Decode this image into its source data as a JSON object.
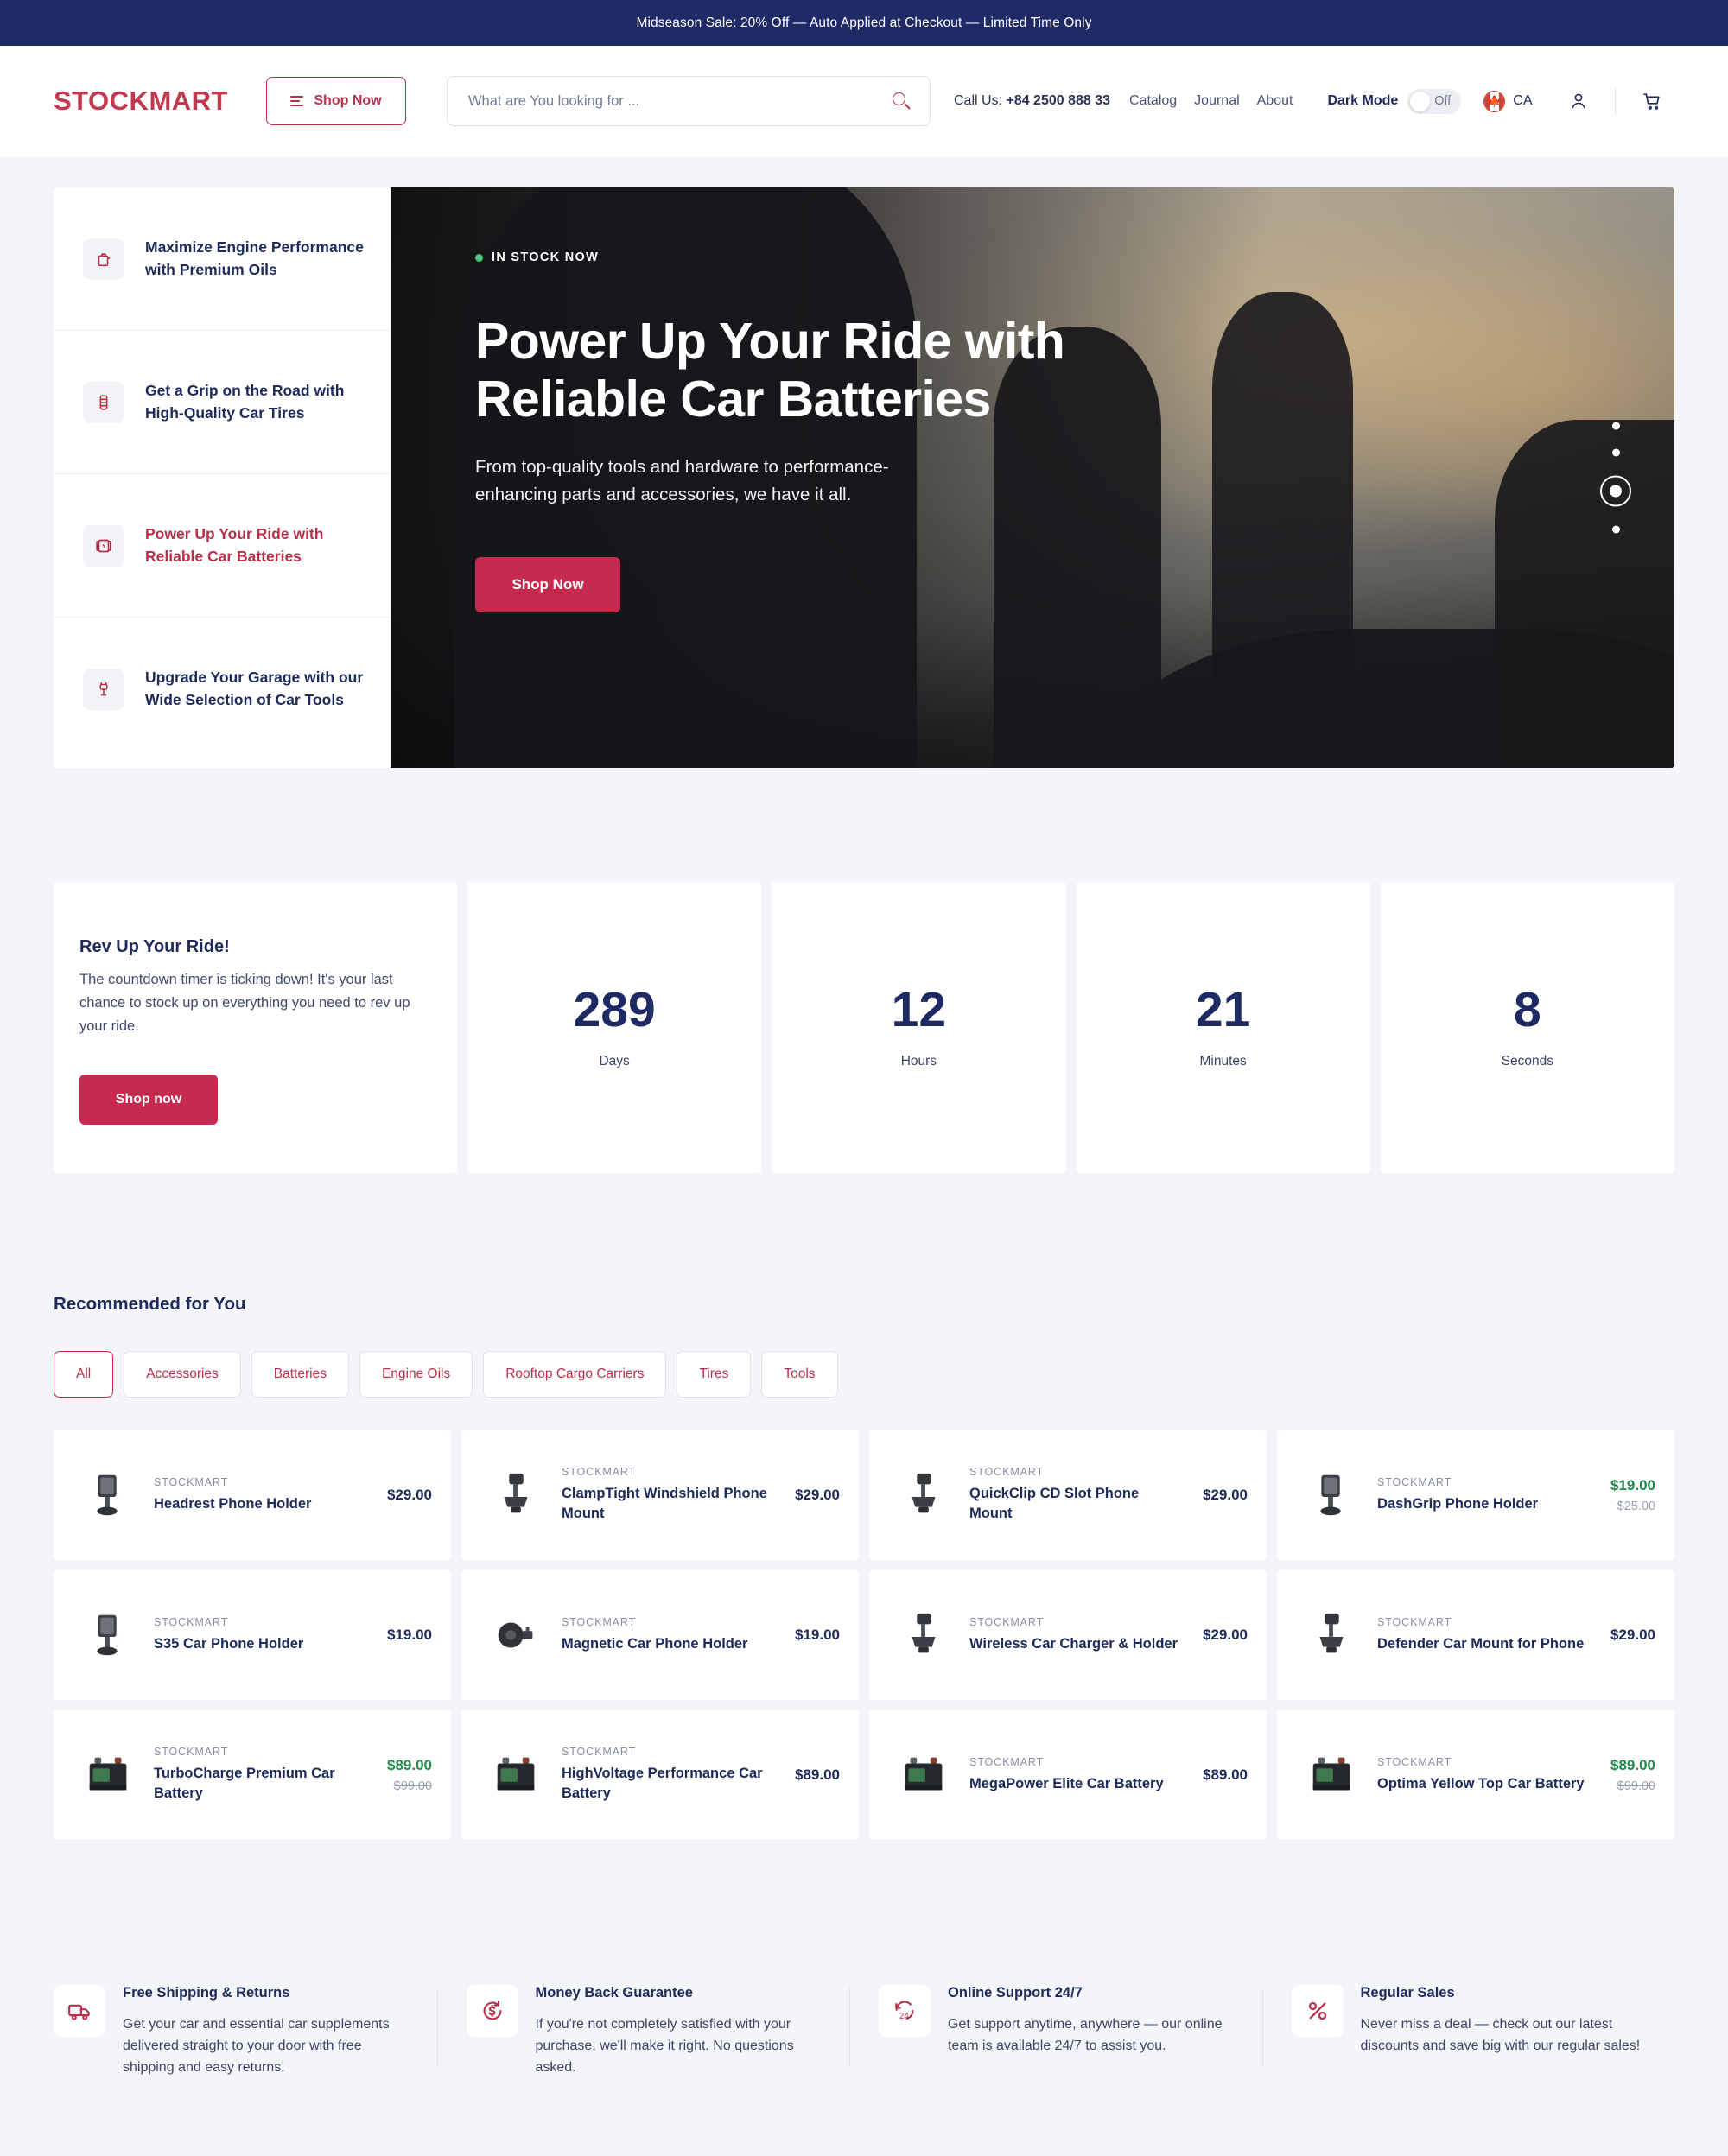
{
  "announcement": {
    "text": "Midseason Sale: 20% Off — Auto Applied at Checkout — Limited Time Only"
  },
  "header": {
    "logo": "STOCKMART",
    "shop_now": "Shop Now",
    "search_placeholder": "What are You looking for ...",
    "search_value": "",
    "call_label": "Call Us:",
    "phone": "+84 2500 888 33",
    "nav": [
      {
        "label": "Catalog"
      },
      {
        "label": "Journal"
      },
      {
        "label": "About"
      }
    ],
    "dark_mode_label": "Dark Mode",
    "dark_mode_state": "Off",
    "region_code": "CA"
  },
  "hero": {
    "items": [
      {
        "label": "Maximize Engine Performance with Premium Oils",
        "icon": "oil-can-icon",
        "active": false
      },
      {
        "label": "Get a Grip on the Road with High-Quality Car Tires",
        "icon": "tire-icon",
        "active": false
      },
      {
        "label": "Power Up Your Ride with Reliable Car Batteries",
        "icon": "battery-icon",
        "active": true
      },
      {
        "label": "Upgrade Your Garage with our Wide Selection of Car Tools",
        "icon": "tools-icon",
        "active": false
      }
    ],
    "badge": "IN STOCK NOW",
    "title": "Power Up Your Ride with Reliable Car Batteries",
    "subtitle": "From top-quality tools and hardware to performance-enhancing parts and accessories, we have it all.",
    "cta": "Shop Now",
    "slide_count": 4,
    "active_slide": 3
  },
  "countdown": {
    "title": "Rev Up Your Ride!",
    "description": "The countdown timer is ticking down! It's your last chance to stock up on everything you need to rev up your ride.",
    "cta": "Shop now",
    "cells": [
      {
        "value": "289",
        "label": "Days"
      },
      {
        "value": "12",
        "label": "Hours"
      },
      {
        "value": "21",
        "label": "Minutes"
      },
      {
        "value": "8",
        "label": "Seconds"
      }
    ]
  },
  "recommended": {
    "heading": "Recommended for You",
    "filters": [
      {
        "label": "All",
        "active": true
      },
      {
        "label": "Accessories",
        "active": false
      },
      {
        "label": "Batteries",
        "active": false
      },
      {
        "label": "Engine Oils",
        "active": false
      },
      {
        "label": "Rooftop Cargo Carriers",
        "active": false
      },
      {
        "label": "Tires",
        "active": false
      },
      {
        "label": "Tools",
        "active": false
      }
    ],
    "products": [
      {
        "brand": "STOCKMART",
        "name": "Headrest Phone Holder",
        "price": "$29.00",
        "compare": "",
        "on_sale": false,
        "thumb": "phone-holder-icon"
      },
      {
        "brand": "STOCKMART",
        "name": "ClampTight Windshield Phone Mount",
        "price": "$29.00",
        "compare": "",
        "on_sale": false,
        "thumb": "phone-mount-icon"
      },
      {
        "brand": "STOCKMART",
        "name": "QuickClip CD Slot Phone Mount",
        "price": "$29.00",
        "compare": "",
        "on_sale": false,
        "thumb": "phone-mount-icon"
      },
      {
        "brand": "STOCKMART",
        "name": "DashGrip Phone Holder",
        "price": "$19.00",
        "compare": "$25.00",
        "on_sale": true,
        "thumb": "phone-holder-icon"
      },
      {
        "brand": "STOCKMART",
        "name": "S35 Car Phone Holder",
        "price": "$19.00",
        "compare": "",
        "on_sale": false,
        "thumb": "phone-holder-icon"
      },
      {
        "brand": "STOCKMART",
        "name": "Magnetic Car Phone Holder",
        "price": "$19.00",
        "compare": "",
        "on_sale": false,
        "thumb": "magnetic-mount-icon"
      },
      {
        "brand": "STOCKMART",
        "name": "Wireless Car Charger & Holder",
        "price": "$29.00",
        "compare": "",
        "on_sale": false,
        "thumb": "phone-mount-icon"
      },
      {
        "brand": "STOCKMART",
        "name": "Defender Car Mount for Phone",
        "price": "$29.00",
        "compare": "",
        "on_sale": false,
        "thumb": "phone-mount-icon"
      },
      {
        "brand": "STOCKMART",
        "name": "TurboCharge Premium Car Battery",
        "price": "$89.00",
        "compare": "$99.00",
        "on_sale": true,
        "thumb": "car-battery-icon"
      },
      {
        "brand": "STOCKMART",
        "name": "HighVoltage Performance Car Battery",
        "price": "$89.00",
        "compare": "",
        "on_sale": false,
        "thumb": "car-battery-icon"
      },
      {
        "brand": "STOCKMART",
        "name": "MegaPower Elite Car Battery",
        "price": "$89.00",
        "compare": "",
        "on_sale": false,
        "thumb": "car-battery-icon"
      },
      {
        "brand": "STOCKMART",
        "name": "Optima Yellow Top Car Battery",
        "price": "$89.00",
        "compare": "$99.00",
        "on_sale": true,
        "thumb": "car-battery-icon"
      }
    ]
  },
  "benefits": [
    {
      "icon": "truck-icon",
      "title": "Free Shipping & Returns",
      "text": "Get your car and essential car supplements delivered straight to your door with free shipping and easy returns."
    },
    {
      "icon": "refund-icon",
      "title": "Money Back Guarantee",
      "text": "If you're not completely satisfied with your purchase, we'll make it right. No questions asked."
    },
    {
      "icon": "support-24-icon",
      "title": "Online Support 24/7",
      "text": "Get support anytime, anywhere — our online team is available 24/7 to assist you."
    },
    {
      "icon": "percent-icon",
      "title": "Regular Sales",
      "text": "Never miss a deal — check out our latest discounts and save big with our regular sales!"
    }
  ],
  "colors": {
    "brand": "#b8304a",
    "accent": "#c72a4f",
    "navy": "#1d2a5b",
    "banner": "#202a66",
    "sale": "#1f8a4c"
  }
}
